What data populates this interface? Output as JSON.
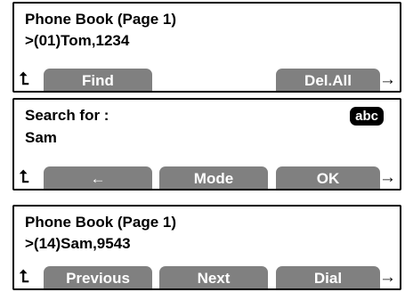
{
  "screens": [
    {
      "line1": "Phone Book (Page 1)",
      "line2": ">(01)Tom,1234",
      "nav_left": "⮤",
      "nav_right": "→",
      "softkeys": [
        "Find",
        "",
        "",
        "Del.All"
      ]
    },
    {
      "line1": "Search for :",
      "line2": "Sam",
      "badge": "abc",
      "nav_left": "⮤",
      "nav_right": "→",
      "softkeys": [
        "",
        "←",
        "Mode",
        "OK"
      ]
    },
    {
      "line1": "Phone Book (Page 1)",
      "line2": ">(14)Sam,9543",
      "nav_left": "⮤",
      "nav_right": "→",
      "softkeys": [
        "Previous",
        "Next",
        "",
        "Dial"
      ]
    }
  ]
}
